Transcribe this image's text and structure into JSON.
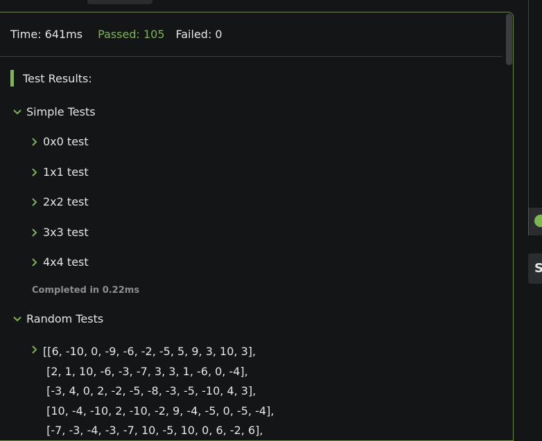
{
  "summary": {
    "time": "Time: 641ms",
    "passed": "Passed: 105",
    "failed": "Failed: 0"
  },
  "results": {
    "title": "Test Results:"
  },
  "groups": [
    {
      "label": "Simple Tests",
      "items": [
        "0x0 test",
        "1x1 test",
        "2x2 test",
        "3x3 test",
        "4x4 test"
      ],
      "completed": "Completed in 0.22ms"
    },
    {
      "label": "Random Tests",
      "items": [
        [
          "[[6, -10, 0, -9, -6, -2, -5, 5, 9, 3, 10, 3],",
          " [2, 1, 10, -6, -3, -7, 3, 3, 1, -6, 0, -4],",
          " [-3, 4, 0, 2, -2, -5, -8, -3, -5, -10, 4, 3],",
          " [10, -4, -10, 2, -10, -2, 9, -4, -5, 0, -5, -4],",
          " [-7, -3, -4, -3, -7, 10, -5, 10, 0, 6, -2, 6],"
        ]
      ]
    }
  ],
  "right_panel": {
    "card_letter": "S"
  },
  "colors": {
    "accent_green": "#7ab94a",
    "border_green": "#6c8f3a",
    "background": "#131516",
    "muted_text": "#8c8f91"
  }
}
